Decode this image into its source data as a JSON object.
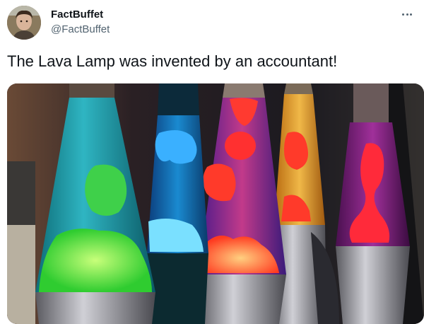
{
  "tweet": {
    "display_name": "FactBuffet",
    "handle": "@FactBuffet",
    "text": "The Lava Lamp was invented by an accountant!"
  },
  "icons": {
    "avatar": "profile-photo",
    "more": "more-options-icon"
  },
  "media": {
    "subject": "lava lamps",
    "lamp_colors": [
      "green",
      "blue",
      "red-purple",
      "orange",
      "purple"
    ]
  },
  "colors": {
    "text_primary": "#0f1419",
    "text_secondary": "#536471"
  }
}
